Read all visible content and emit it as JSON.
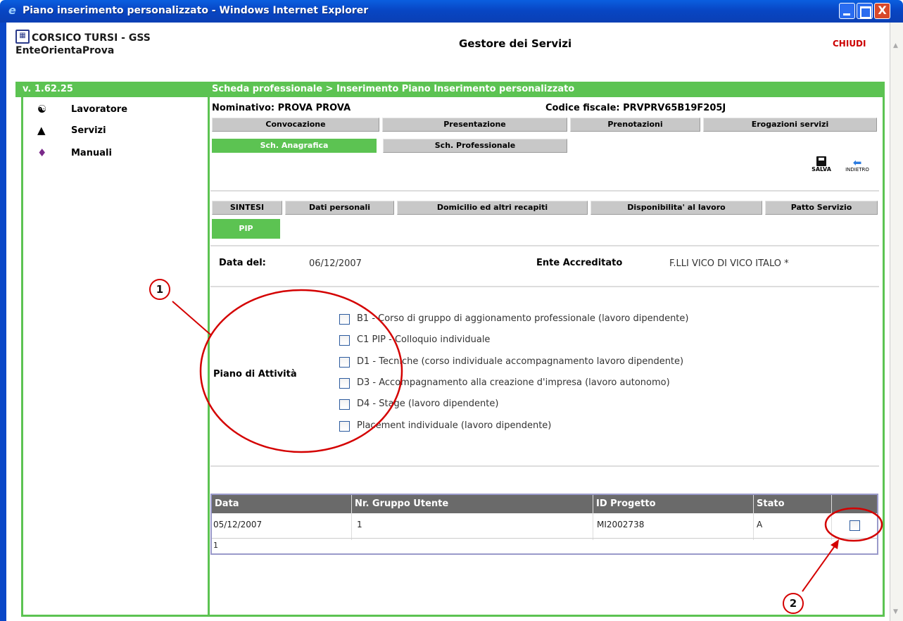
{
  "window": {
    "title": "Piano inserimento personalizzato - Windows Internet Explorer",
    "close_glyph": "X"
  },
  "header": {
    "org_name": "CORSICO TURSI - GSS",
    "org_sub": "EnteOrientaProva",
    "app_title": "Gestore dei Servizi",
    "close_label": "CHIUDI",
    "version": "v. 1.62.25",
    "breadcrumb": "Scheda professionale > Inserimento Piano Inserimento personalizzato"
  },
  "sidebar": {
    "items": [
      {
        "label": "Lavoratore",
        "icon": "worker-icon"
      },
      {
        "label": "Servizi",
        "icon": "services-icon"
      },
      {
        "label": "Manuali",
        "icon": "books-icon"
      }
    ]
  },
  "person": {
    "nominativo": "Nominativo: PROVA  PROVA",
    "codice_fiscale": "Codice fiscale: PRVPRV65B19F205J"
  },
  "tabs_row1": [
    "Convocazione",
    "Presentazione",
    "Prenotazioni",
    "Erogazioni servizi"
  ],
  "tabs_row2": [
    "Sch. Anagrafica",
    "Sch. Professionale"
  ],
  "toolbar": {
    "save_label": "SALVA",
    "back_label": "INDIETRO"
  },
  "subtabs_row1": [
    "SINTESI",
    "Dati personali",
    "Domicilio ed altri recapiti",
    "Disponibilita' al lavoro",
    "Patto Servizio"
  ],
  "subtabs_row2": [
    "PIP"
  ],
  "form": {
    "data_label": "Data del:",
    "data_value": "06/12/2007",
    "ente_label": "Ente Accreditato",
    "ente_value": "F.LLI VICO DI VICO ITALO *",
    "piano_label": "Piano di Attività",
    "activities": [
      "B1 - Corso di gruppo di aggionamento professionale (lavoro dipendente)",
      "C1 PIP - Colloquio individuale",
      "D1 - Tecniche (corso individuale accompagnamento lavoro dipendente)",
      "D3 - Accompagnamento alla creazione d'impresa (lavoro autonomo)",
      "D4 - Stage (lavoro dipendente)",
      "Placement individuale (lavoro dipendente)"
    ]
  },
  "table": {
    "headers": [
      "Data",
      "Nr. Gruppo Utente",
      "ID Progetto",
      "Stato"
    ],
    "rows": [
      {
        "data": "05/12/2007",
        "gruppo": "1",
        "progetto": "MI2002738",
        "stato": "A"
      }
    ],
    "footer": "1"
  },
  "annotations": {
    "marker1": "1",
    "marker2": "2",
    "color": "#d40000"
  },
  "colors": {
    "accent_green": "#5cc352",
    "title_blue": "#0846c4",
    "close_red": "#cc0000"
  }
}
